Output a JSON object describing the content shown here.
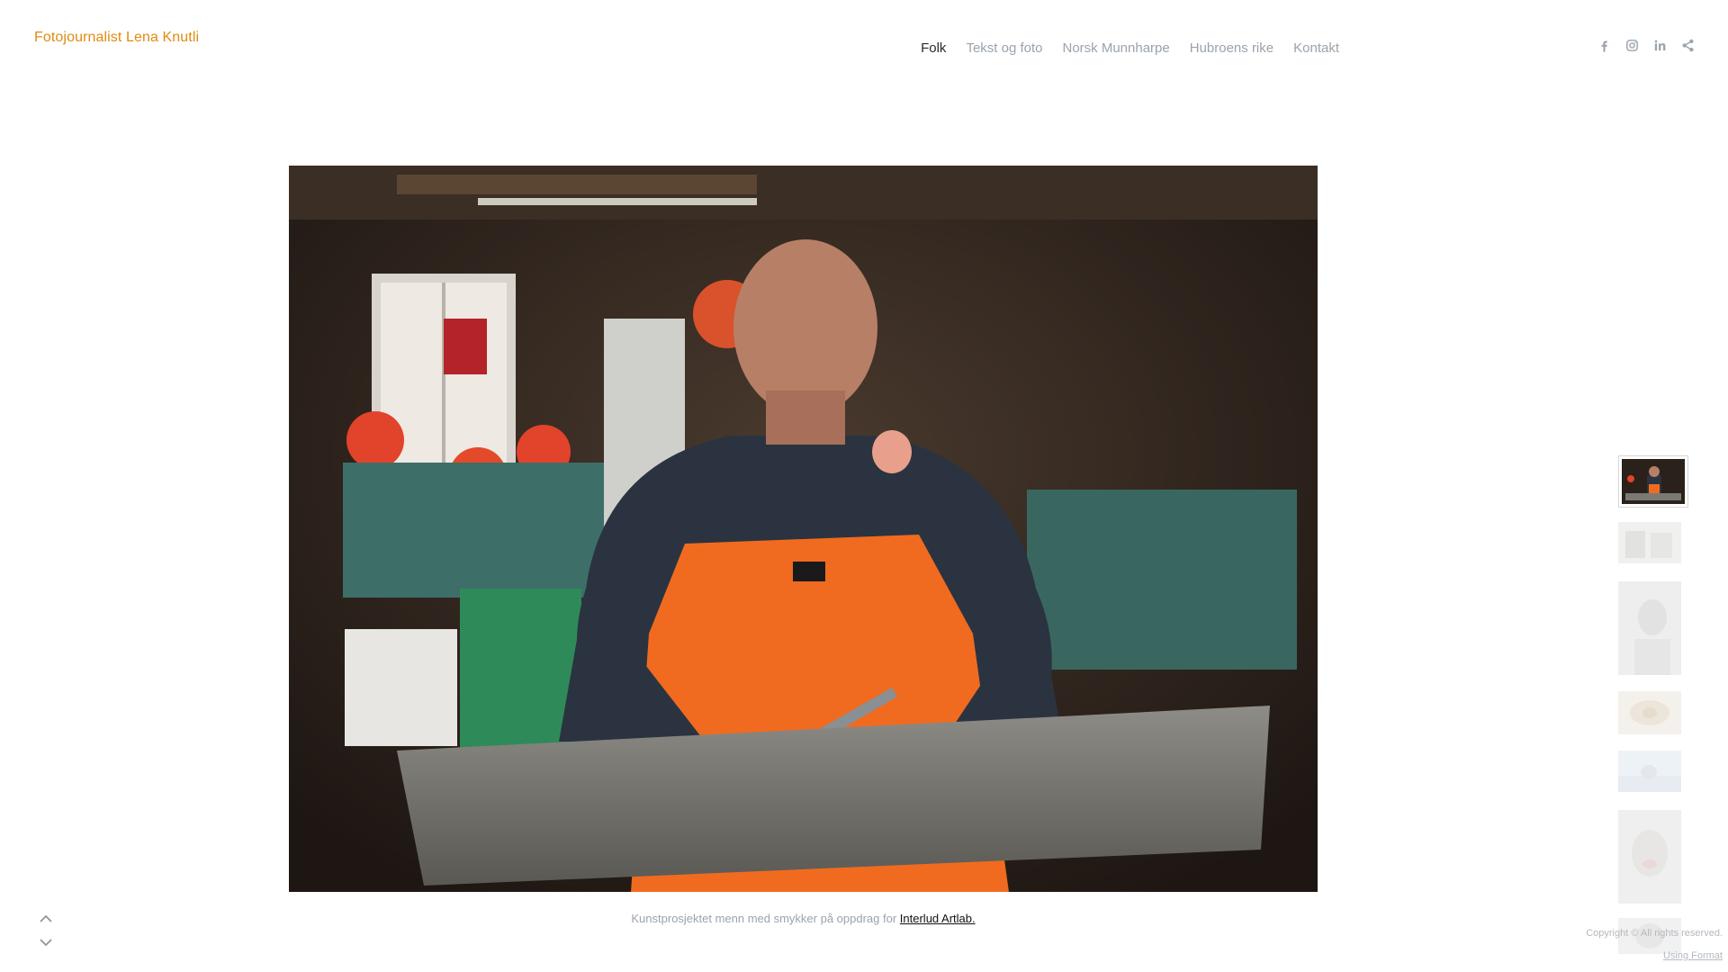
{
  "site": {
    "title": "Fotojournalist Lena Knutli"
  },
  "nav": {
    "items": [
      {
        "label": "Folk",
        "active": true
      },
      {
        "label": "Tekst og foto",
        "active": false
      },
      {
        "label": "Norsk Munnharpe",
        "active": false
      },
      {
        "label": "Hubroens rike",
        "active": false
      },
      {
        "label": "Kontakt",
        "active": false
      }
    ]
  },
  "social": {
    "icons": [
      "facebook-icon",
      "instagram-icon",
      "linkedin-icon",
      "share-icon"
    ],
    "color": "#9aa3ad"
  },
  "caption": {
    "text": "Kunstprosjektet menn med smykker på oppdrag for ",
    "link_text": "Interlud Artlab."
  },
  "footer": {
    "copyright": "Copyright © All rights reserved.",
    "using_format": "Using Format"
  },
  "colors": {
    "brand": "#e08a12",
    "nav_inactive": "#9aa3ad",
    "nav_active": "#2b2b2b"
  }
}
